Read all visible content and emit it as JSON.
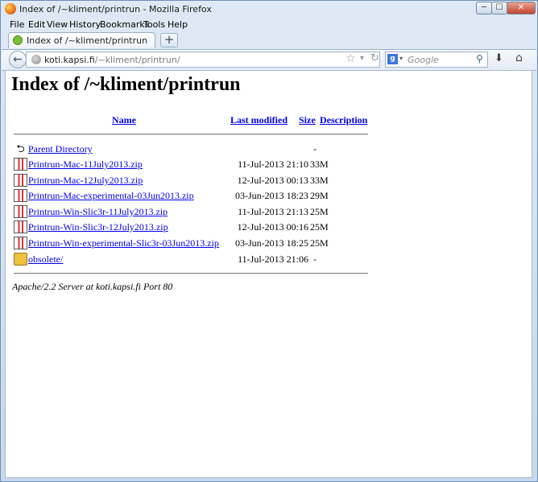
{
  "window": {
    "title": "Index of /~kliment/printrun - Mozilla Firefox",
    "min_label": "─",
    "max_label": "☐",
    "close_label": "✕"
  },
  "menu": [
    "File",
    "Edit",
    "View",
    "History",
    "Bookmarks",
    "Tools",
    "Help"
  ],
  "tab": {
    "label": "Index of /~kliment/printrun"
  },
  "newtab_label": "+",
  "nav": {
    "back_label": "←",
    "url_domain": "koti.kapsi.fi",
    "url_path": "/~kliment/printrun/",
    "search_placeholder": "Google",
    "search_engine_letter": "g"
  },
  "page": {
    "heading": "Index of /~kliment/printrun",
    "columns": {
      "name": "Name",
      "modified": "Last modified",
      "size": "Size",
      "description": "Description"
    },
    "entries": [
      {
        "icon": "back-icon",
        "name": "Parent Directory",
        "date": "",
        "size": "-"
      },
      {
        "icon": "zip-icon",
        "name": "Printrun-Mac-11July2013.zip",
        "date": "11-Jul-2013 21:10",
        "size": "33M"
      },
      {
        "icon": "zip-icon",
        "name": "Printrun-Mac-12July2013.zip",
        "date": "12-Jul-2013 00:13",
        "size": "33M"
      },
      {
        "icon": "zip-icon",
        "name": "Printrun-Mac-experimental-03Jun2013.zip",
        "date": "03-Jun-2013 18:23",
        "size": "29M"
      },
      {
        "icon": "zip-icon",
        "name": "Printrun-Win-Slic3r-11July2013.zip",
        "date": "11-Jul-2013 21:13",
        "size": "25M"
      },
      {
        "icon": "zip-icon",
        "name": "Printrun-Win-Slic3r-12July2013.zip",
        "date": "12-Jul-2013 00:16",
        "size": "25M"
      },
      {
        "icon": "zip-icon",
        "name": "Printrun-Win-experimental-Slic3r-03Jun2013.zip",
        "date": "03-Jun-2013 18:25",
        "size": "25M"
      },
      {
        "icon": "folder-icon",
        "name": "obsolete/",
        "date": "11-Jul-2013 21:06",
        "size": "-"
      }
    ],
    "address": "Apache/2.2 Server at koti.kapsi.fi Port 80"
  }
}
